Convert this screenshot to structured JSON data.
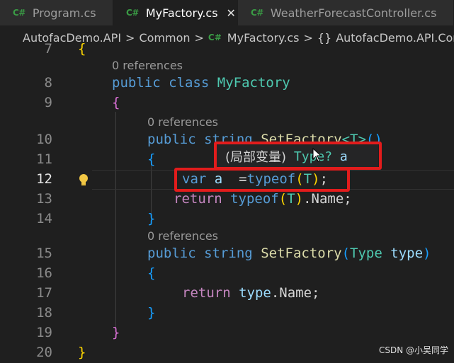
{
  "tabs": [
    {
      "icon": "C#",
      "label": "Program.cs"
    },
    {
      "icon": "C#",
      "label": "MyFactory.cs",
      "close": "✕"
    },
    {
      "icon": "C#",
      "label": "WeatherForecastController.cs"
    }
  ],
  "breadcrumb": {
    "items": [
      "AutofacDemo.API",
      "Common",
      "MyFactory.cs",
      "AutofacDemo.API.Common"
    ],
    "cs_icon": "C#",
    "braces": "{}",
    "sep": ">"
  },
  "editor": {
    "references": "0 references",
    "line_numbers": [
      "7",
      "8",
      "9",
      "10",
      "11",
      "12",
      "13",
      "14",
      "15",
      "16",
      "17",
      "18",
      "19",
      "20"
    ],
    "line7": "{",
    "line8": {
      "kw1": "public",
      "kw2": "class",
      "name": "MyFactory"
    },
    "line9": "{",
    "line10": {
      "kw1": "public",
      "kw2": "string",
      "name": "SetFactory",
      "generic": "<T>",
      "parens": "()"
    },
    "line11": "{",
    "line12": {
      "var": "var",
      "name": "a",
      "rest": "=",
      "typeof": "typeof",
      "open": "(",
      "t": "T",
      "close": ")",
      "semi": ";"
    },
    "line13": {
      "ret": "return",
      "typeof": "typeof",
      "open": "(",
      "t": "T",
      "close": ")",
      "prop": ".Name;"
    },
    "line14": "}",
    "line15": {
      "kw1": "public",
      "kw2": "string",
      "name": "SetFactory",
      "open": "(",
      "type": "Type",
      "param": "type",
      "close": ")"
    },
    "line16": "{",
    "line17": {
      "ret": "return",
      "obj": "type",
      "prop": ".Name;"
    },
    "line18": "}",
    "line19": "}",
    "line20": "}"
  },
  "tooltip": {
    "prefix": "(局部变量)",
    "type": "Type?",
    "name": "a"
  },
  "watermark": "CSDN @小吴同学"
}
